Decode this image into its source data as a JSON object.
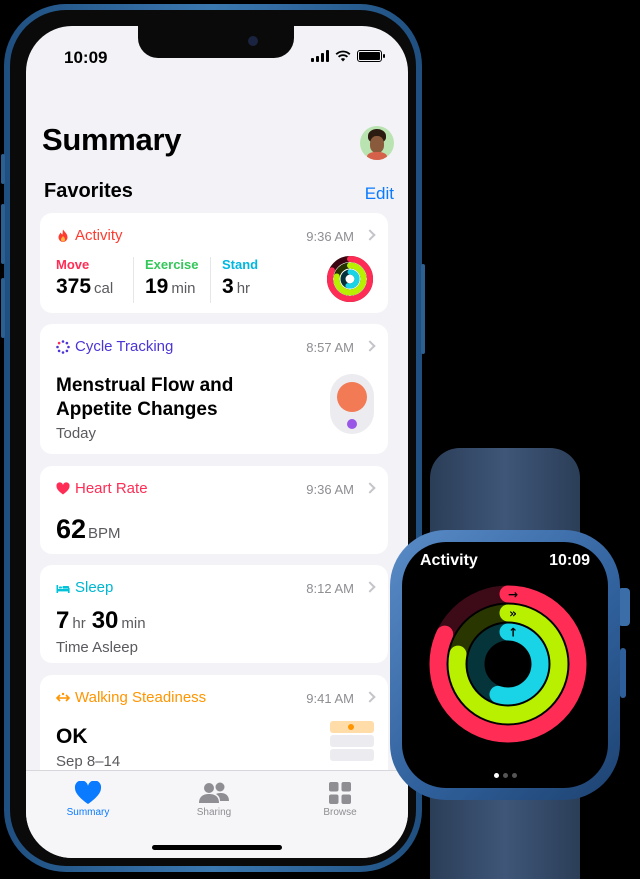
{
  "phone": {
    "status": {
      "time": "10:09"
    },
    "title": "Summary",
    "favorites": {
      "header": "Favorites",
      "edit": "Edit"
    },
    "cards": {
      "activity": {
        "title": "Activity",
        "time": "9:36 AM",
        "move": {
          "label": "Move",
          "value": "375",
          "unit": "cal"
        },
        "exercise": {
          "label": "Exercise",
          "value": "19",
          "unit": "min"
        },
        "stand": {
          "label": "Stand",
          "value": "3",
          "unit": "hr"
        }
      },
      "cycle": {
        "title": "Cycle Tracking",
        "time": "8:57 AM",
        "line1": "Menstrual Flow and",
        "line2": "Appetite Changes",
        "sub": "Today"
      },
      "heart": {
        "title": "Heart Rate",
        "time": "9:36 AM",
        "value": "62",
        "unit": "BPM"
      },
      "sleep": {
        "title": "Sleep",
        "time": "8:12 AM",
        "hours": "7",
        "hours_unit": "hr",
        "minutes": "30",
        "minutes_unit": "min",
        "sub": "Time Asleep"
      },
      "walking": {
        "title": "Walking Steadiness",
        "time": "9:41 AM",
        "value": "OK",
        "sub": "Sep 8–14"
      }
    },
    "tabs": [
      {
        "label": "Summary",
        "icon": "heart-icon",
        "active": true
      },
      {
        "label": "Sharing",
        "icon": "people-icon",
        "active": false
      },
      {
        "label": "Browse",
        "icon": "grid-icon",
        "active": false
      }
    ]
  },
  "watch": {
    "title": "Activity",
    "time": "10:09",
    "rings": {
      "move": 0.82,
      "exercise": 0.78,
      "stand": 0.55
    },
    "page": 1,
    "pages": 3
  },
  "colors": {
    "move": "#ff2d55",
    "exercise": "#b8f000",
    "stand": "#19d3e6",
    "activity": "#ff3b30",
    "exercise_label": "#34c759",
    "stand_label": "#00b7e0",
    "cycle": "#4b35d6",
    "heart": "#ff2d55",
    "sleep": "#00c3d9",
    "walking": "#ff9500",
    "accent": "#0a7aff"
  }
}
